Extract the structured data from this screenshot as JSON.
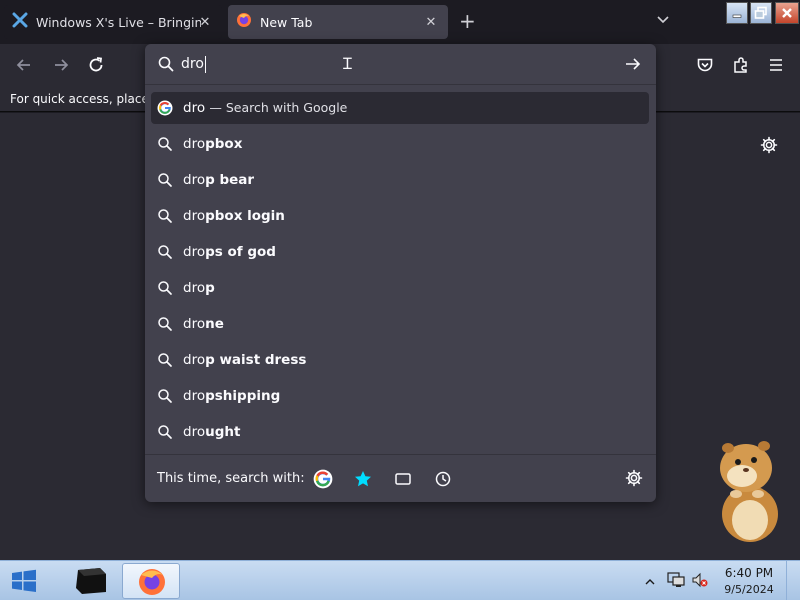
{
  "tabs": [
    {
      "title": "Windows X's Live – Bringing the",
      "icon": "windows-x-live-favicon"
    },
    {
      "title": "New Tab",
      "icon": "firefox-icon",
      "active": true
    }
  ],
  "bookmarks_bar": {
    "message": "For quick access, place yo"
  },
  "urlbar": {
    "value": "dro",
    "google_row": {
      "typed": "dro",
      "sub": "— Search with Google"
    },
    "suggestions": [
      {
        "typed": "dro",
        "completion": "pbox"
      },
      {
        "typed": "dro",
        "completion": "p bear"
      },
      {
        "typed": "dro",
        "completion": "pbox login"
      },
      {
        "typed": "dro",
        "completion": "ps of god"
      },
      {
        "typed": "dro",
        "completion": "p"
      },
      {
        "typed": "dro",
        "completion": "ne"
      },
      {
        "typed": "dro",
        "completion": "p waist dress"
      },
      {
        "typed": "dro",
        "completion": "pshipping"
      },
      {
        "typed": "dro",
        "completion": "ught"
      }
    ],
    "oneoff_label": "This time, search with:"
  },
  "taskbar": {
    "time": "6:40 PM",
    "date": "9/5/2024"
  },
  "colors": {
    "accent": "#00ddff",
    "toolbar": "#2b2a33",
    "popup": "#42414d",
    "selected_row": "#2b2a33"
  }
}
